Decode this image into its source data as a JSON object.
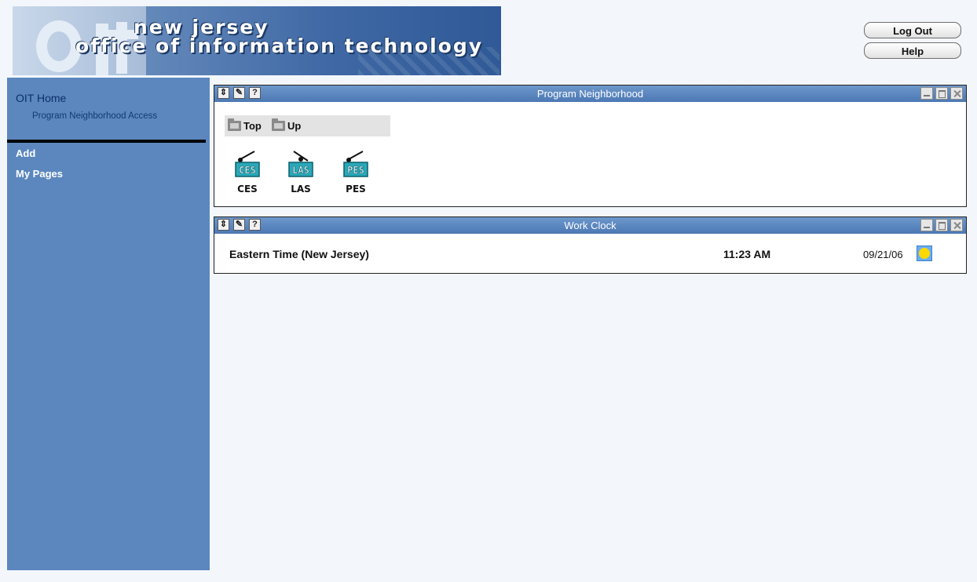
{
  "header": {
    "banner_line1": "new jersey",
    "banner_line2": "office of information technology",
    "logout_label": "Log Out",
    "help_label": "Help"
  },
  "sidebar": {
    "home_label": "OIT Home",
    "sub_label": "Program Neighborhood Access",
    "add_label": "Add",
    "pages_label": "My Pages"
  },
  "portlets": {
    "program": {
      "title": "Program Neighborhood",
      "nav_top": "Top",
      "nav_up": "Up",
      "apps": [
        {
          "label": "CES",
          "icon": "ces-app-icon"
        },
        {
          "label": "LAS",
          "icon": "las-app-icon"
        },
        {
          "label": "PES",
          "icon": "pes-app-icon"
        }
      ]
    },
    "clock": {
      "title": "Work Clock",
      "timezone": "Eastern Time (New Jersey)",
      "time": "11:23 AM",
      "date": "09/21/06",
      "weather_icon": "sun-icon"
    },
    "tools": {
      "refresh": "⇕",
      "edit": "✎",
      "help": "?"
    }
  },
  "colors": {
    "sidebar": "#5b87be",
    "titlebar": "#5a86c0",
    "app_icon": "#2aa8b8"
  }
}
